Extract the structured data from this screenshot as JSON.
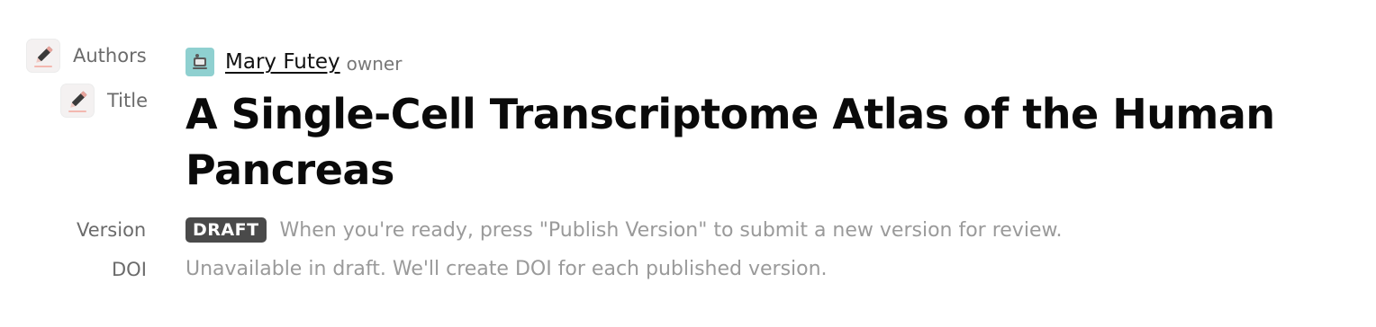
{
  "labels": {
    "authors": "Authors",
    "title": "Title",
    "version": "Version",
    "doi": "DOI"
  },
  "author": {
    "name": "Mary Futey",
    "role": "owner",
    "avatar_icon": "avatar-illustration-icon",
    "avatar_color": "#8fd0d0"
  },
  "title": "A Single-Cell Transcriptome Atlas of the Human Pancreas",
  "version": {
    "badge": "DRAFT",
    "note": "When you're ready, press \"Publish Version\" to submit a new version for review."
  },
  "doi": {
    "note": "Unavailable in draft. We'll create DOI for each published version."
  },
  "icons": {
    "authors_edit": "pencil-edit-icon",
    "title_edit": "pencil-edit-icon"
  },
  "colors": {
    "edit_icon_accent": "#e8a39b",
    "badge_bg": "#4a4a4a"
  }
}
